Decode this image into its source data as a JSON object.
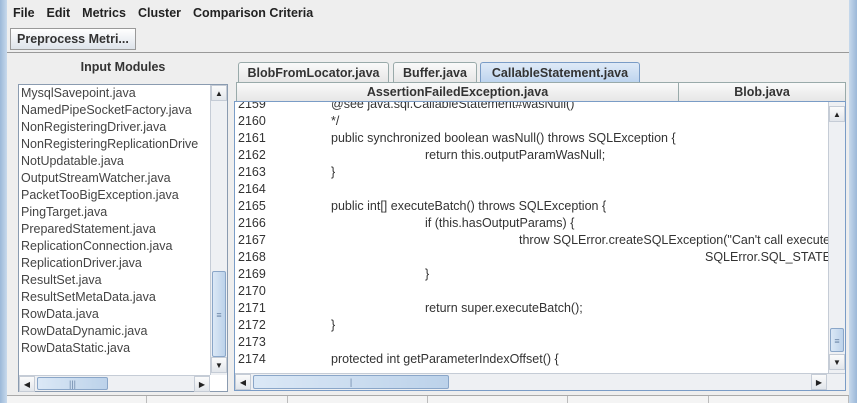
{
  "menu": [
    "File",
    "Edit",
    "Metrics",
    "Cluster",
    "Comparison Criteria"
  ],
  "toolbar": {
    "preprocess_label": "Preprocess Metri..."
  },
  "left": {
    "heading": "Input Modules",
    "items": [
      "MysqlSavepoint.java",
      "NamedPipeSocketFactory.java",
      "NonRegisteringDriver.java",
      "NonRegisteringReplicationDrive",
      "NotUpdatable.java",
      "OutputStreamWatcher.java",
      "PacketTooBigException.java",
      "PingTarget.java",
      "PreparedStatement.java",
      "ReplicationConnection.java",
      "ReplicationDriver.java",
      "ResultSet.java",
      "ResultSetMetaData.java",
      "RowData.java",
      "RowDataDynamic.java",
      "RowDataStatic.java"
    ]
  },
  "tabs_row1": [
    {
      "label": "BlobFromLocator.java"
    },
    {
      "label": "Buffer.java"
    },
    {
      "label": "CallableStatement.java",
      "selected": true
    }
  ],
  "tabs_row2": [
    {
      "label": "AssertionFailedException.java"
    },
    {
      "label": "Blob.java"
    }
  ],
  "code": [
    {
      "n": "2159",
      "indent": 1,
      "t": "  @see java.sql.CallableStatement#wasNull()"
    },
    {
      "n": "2160",
      "indent": 1,
      "t": " */"
    },
    {
      "n": "2161",
      "indent": 1,
      "t": "public synchronized boolean wasNull() throws SQLException {"
    },
    {
      "n": "2162",
      "indent": 2,
      "t": "return this.outputParamWasNull;"
    },
    {
      "n": "2163",
      "indent": 1,
      "t": "}"
    },
    {
      "n": "2164",
      "indent": 0,
      "t": ""
    },
    {
      "n": "2165",
      "indent": 1,
      "t": "public int[] executeBatch() throws SQLException {"
    },
    {
      "n": "2166",
      "indent": 2,
      "t": "if (this.hasOutputParams) {"
    },
    {
      "n": "2167",
      "indent": 3,
      "t": "throw SQLError.createSQLException(\"Can't call executeBatch() on CallableStatement with OUTPUT parameters\","
    },
    {
      "n": "2168",
      "indent": 4,
      "t": "SQLError.SQL_STATE_ILLEGAL_ARGUMENT);"
    },
    {
      "n": "2169",
      "indent": 2,
      "t": "}"
    },
    {
      "n": "2170",
      "indent": 0,
      "t": ""
    },
    {
      "n": "2171",
      "indent": 2,
      "t": "return super.executeBatch();"
    },
    {
      "n": "2172",
      "indent": 1,
      "t": "}"
    },
    {
      "n": "2173",
      "indent": 0,
      "t": ""
    },
    {
      "n": "2174",
      "indent": 1,
      "t": "protected int getParameterIndexOffset() {"
    }
  ]
}
